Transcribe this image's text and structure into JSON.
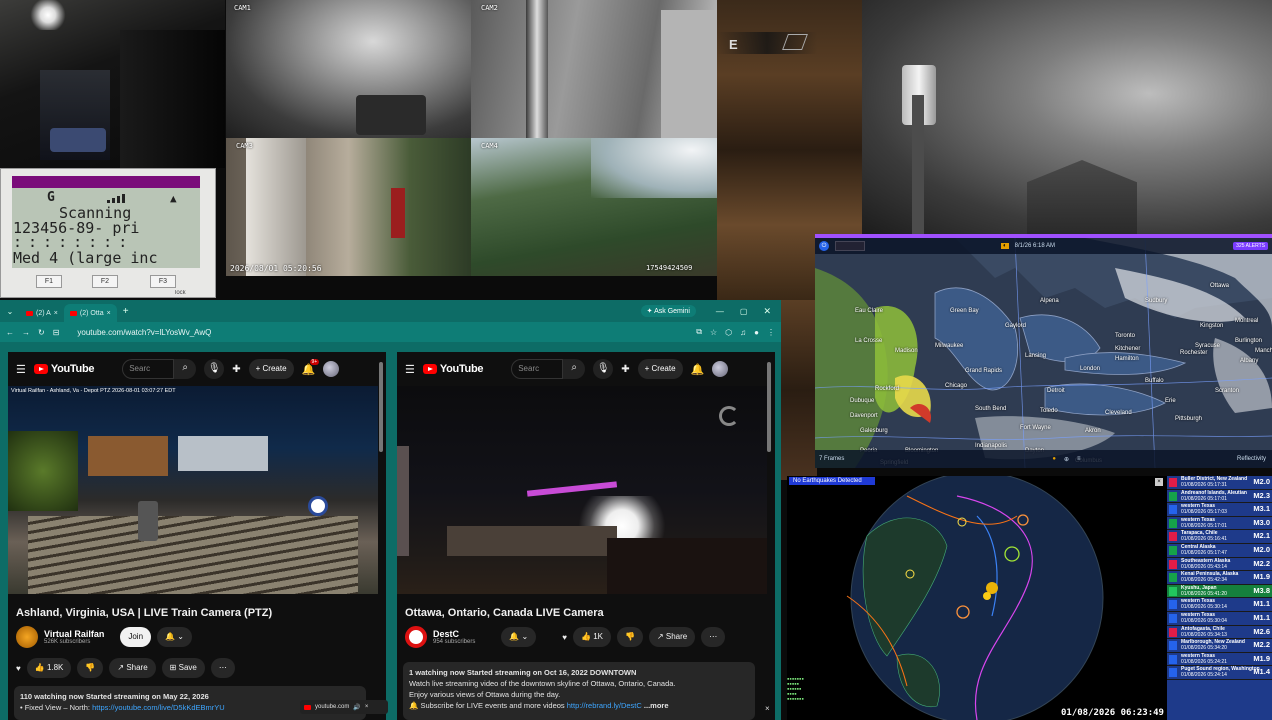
{
  "cams": {
    "cam1": "CAM1",
    "cam2": "CAM2",
    "cam3": "CAM3",
    "cam4": "CAM4",
    "timestamp": "2026/08/01 05:20:56",
    "counter": "17549424509"
  },
  "scanner": {
    "mode": "G",
    "status": "Scanning",
    "channels": "123456-89-  pri",
    "dots": "::::::::",
    "label": "Med 4 (large inc",
    "f1": "F1",
    "f2": "F2",
    "f3": "F3",
    "lock": "lock"
  },
  "game": {
    "compass": "E"
  },
  "browser": {
    "tabs": [
      {
        "label": "(2) A"
      },
      {
        "label": "(2) Otta"
      }
    ],
    "new_tab": "+",
    "ask": "Ask Gemini",
    "url": "youtube.com/watch?v=lLYosWv_AwQ",
    "bottom_url": "youtube.com"
  },
  "left_video": {
    "search_placeholder": "Searc",
    "create": "Create",
    "notif_badge": "9+",
    "overlay": "Virtual Railfan - Ashland, Va - Depot PTZ  2026-08-01 03:07:27 EDT",
    "title": "Ashland, Virginia, USA | LIVE Train Camera (PTZ)",
    "channel": "Virtual Railfan",
    "subs": "526K subscribers",
    "join": "Join",
    "likes": "1.8K",
    "share": "Share",
    "save": "Save",
    "desc1": "110 watching now  Started streaming on May 22, 2026",
    "desc2": "• Fixed View – North: ",
    "desc2_link": "https://youtube.com/live/D5kKdEBmrYU"
  },
  "right_video": {
    "logo": "YouTube",
    "search_placeholder": "Searc",
    "create": "Create",
    "title": "Ottawa, Ontario, Canada LIVE Camera",
    "channel": "DestC",
    "subs": "954 subscribers",
    "likes": "1K",
    "share": "Share",
    "desc1": "1 watching now  Started streaming on Oct 16, 2022  DOWNTOWN",
    "desc2": "Watch live streaming video of the downtown skyline of Ottawa, Ontario, Canada.",
    "desc3": "Enjoy various views of Ottawa during the day.",
    "desc4": "Subscribe for LIVE events and more videos ",
    "desc4_link": "http://rebrand.ly/DestC",
    "more": "...more"
  },
  "radar": {
    "time": "8/1/26 6:18 AM",
    "alerts": "325 ALERTS",
    "cities": [
      "Ottawa",
      "Kingston",
      "Syracuse",
      "Albany",
      "Hamilton",
      "Buffalo",
      "Toronto",
      "London",
      "Detroit",
      "Cleveland",
      "Pittsburgh",
      "Akron",
      "Fort Wayne",
      "South Bend",
      "Lansing",
      "Chicago",
      "Madison",
      "Milwaukee",
      "Green Bay",
      "Davenport",
      "Peoria",
      "Springfield",
      "Columbus",
      "Scranton",
      "Rockford",
      "Indianapolis",
      "Dayton",
      "Toledo",
      "Erie",
      "Rochester",
      "Montreal",
      "Burlington",
      "Manchester",
      "Sudbury",
      "Eau Claire",
      "La Crosse",
      "Dubuque",
      "Galesburg",
      "Bloomington",
      "Kitchener",
      "Alpena",
      "Gaylord",
      "Grand Rapids"
    ],
    "frames": "7 Frames",
    "reflectivity": "Reflectivity"
  },
  "quakes": {
    "banner": "No Earthquakes Detected",
    "clock": "01/08/2026 06:23:49",
    "list": [
      {
        "loc": "Buller District, New Zealand",
        "time": "01/08/2026 05:17:31",
        "mag": "M2.0"
      },
      {
        "loc": "Andreanof Islands, Aleutian",
        "time": "01/08/2026 05:17:01",
        "mag": "M2.3"
      },
      {
        "loc": "western Texas",
        "time": "01/08/2026 05:17:03",
        "mag": "M3.1"
      },
      {
        "loc": "western Texas",
        "time": "01/08/2026 05:17:01",
        "mag": "M3.0"
      },
      {
        "loc": "Tarapaca, Chile",
        "time": "01/08/2026 05:16:41",
        "mag": "M2.1"
      },
      {
        "loc": "Central Alaska",
        "time": "01/08/2026 05:17:47",
        "mag": "M2.0"
      },
      {
        "loc": "Southeastern Alaska",
        "time": "01/08/2026 05:43:14",
        "mag": "M2.2"
      },
      {
        "loc": "Kenai Peninsula, Alaska",
        "time": "01/08/2026 05:42:34",
        "mag": "M1.9"
      },
      {
        "loc": "Kyushu, Japan",
        "time": "01/08/2026 05:41:20",
        "mag": "M3.8"
      },
      {
        "loc": "western Texas",
        "time": "01/08/2026 05:30:14",
        "mag": "M1.1"
      },
      {
        "loc": "western Texas",
        "time": "01/08/2026 05:30:04",
        "mag": "M1.1"
      },
      {
        "loc": "Antofagasta, Chile",
        "time": "01/08/2026 05:34:13",
        "mag": "M2.6"
      },
      {
        "loc": "Marlborough, New Zealand",
        "time": "01/08/2026 05:34:20",
        "mag": "M2.2"
      },
      {
        "loc": "western Texas",
        "time": "01/08/2026 05:24:21",
        "mag": "M1.9"
      },
      {
        "loc": "Puget Sound region, Washington",
        "time": "01/08/2026 05:24:14",
        "mag": "M1.4"
      }
    ]
  }
}
